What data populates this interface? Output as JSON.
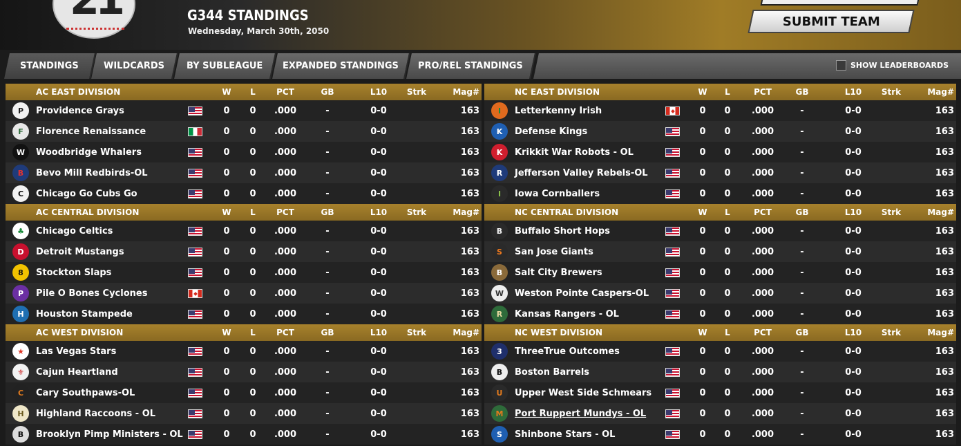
{
  "header": {
    "logo_text": "21",
    "title": "G344 STANDINGS",
    "date": "Wednesday, March 30th, 2050",
    "submit_label": "SUBMIT TEAM"
  },
  "tabs": [
    {
      "label": "STANDINGS",
      "active": true
    },
    {
      "label": "WILDCARDS",
      "active": false
    },
    {
      "label": "BY SUBLEAGUE",
      "active": false
    },
    {
      "label": "EXPANDED STANDINGS",
      "active": false
    },
    {
      "label": "PRO/REL STANDINGS",
      "active": false
    }
  ],
  "leaderboards_label": "SHOW LEADERBOARDS",
  "columns": {
    "w": "W",
    "l": "L",
    "pct": "PCT",
    "gb": "GB",
    "l10": "L10",
    "strk": "Strk",
    "mag": "Mag#"
  },
  "divisions": [
    {
      "name": "AC EAST DIVISION",
      "teams": [
        {
          "name": "Providence Grays",
          "logo": "P",
          "logo_bg": "#f2f2f2",
          "logo_fg": "#222",
          "flag": "us",
          "w": "0",
          "l": "0",
          "pct": ".000",
          "gb": "-",
          "l10": "0-0",
          "strk": "",
          "mag": "163"
        },
        {
          "name": "Florence Renaissance",
          "logo": "F",
          "logo_bg": "#e8e8e8",
          "logo_fg": "#2e6b3a",
          "flag": "it",
          "w": "0",
          "l": "0",
          "pct": ".000",
          "gb": "-",
          "l10": "0-0",
          "strk": "",
          "mag": "163"
        },
        {
          "name": "Woodbridge Whalers",
          "logo": "W",
          "logo_bg": "#111",
          "logo_fg": "#fff",
          "flag": "us",
          "w": "0",
          "l": "0",
          "pct": ".000",
          "gb": "-",
          "l10": "0-0",
          "strk": "",
          "mag": "163"
        },
        {
          "name": "Bevo Mill Redbirds-OL",
          "logo": "B",
          "logo_bg": "#1f3b7a",
          "logo_fg": "#d33",
          "flag": "us",
          "w": "0",
          "l": "0",
          "pct": ".000",
          "gb": "-",
          "l10": "0-0",
          "strk": "",
          "mag": "163"
        },
        {
          "name": "Chicago Go Cubs Go",
          "logo": "C",
          "logo_bg": "#f2f2f2",
          "logo_fg": "#111",
          "flag": "us",
          "w": "0",
          "l": "0",
          "pct": ".000",
          "gb": "-",
          "l10": "0-0",
          "strk": "",
          "mag": "163"
        }
      ]
    },
    {
      "name": "AC CENTRAL DIVISION",
      "teams": [
        {
          "name": "Chicago Celtics",
          "logo": "♣",
          "logo_bg": "#fff",
          "logo_fg": "#1a8a3a",
          "flag": "us",
          "w": "0",
          "l": "0",
          "pct": ".000",
          "gb": "-",
          "l10": "0-0",
          "strk": "",
          "mag": "163"
        },
        {
          "name": "Detroit Mustangs",
          "logo": "D",
          "logo_bg": "#c8102e",
          "logo_fg": "#fff",
          "flag": "us",
          "w": "0",
          "l": "0",
          "pct": ".000",
          "gb": "-",
          "l10": "0-0",
          "strk": "",
          "mag": "163"
        },
        {
          "name": "Stockton Slaps",
          "logo": "8",
          "logo_bg": "#f2c200",
          "logo_fg": "#111",
          "flag": "us",
          "w": "0",
          "l": "0",
          "pct": ".000",
          "gb": "-",
          "l10": "0-0",
          "strk": "",
          "mag": "163"
        },
        {
          "name": "Pile O Bones Cyclones",
          "logo": "P",
          "logo_bg": "#6b2fa3",
          "logo_fg": "#fff",
          "flag": "ca",
          "w": "0",
          "l": "0",
          "pct": ".000",
          "gb": "-",
          "l10": "0-0",
          "strk": "",
          "mag": "163"
        },
        {
          "name": "Houston Stampede",
          "logo": "H",
          "logo_bg": "#1f6fb2",
          "logo_fg": "#fff",
          "flag": "us",
          "w": "0",
          "l": "0",
          "pct": ".000",
          "gb": "-",
          "l10": "0-0",
          "strk": "",
          "mag": "163"
        }
      ]
    },
    {
      "name": "AC WEST DIVISION",
      "teams": [
        {
          "name": "Las Vegas Stars",
          "logo": "★",
          "logo_bg": "#fff",
          "logo_fg": "#d32",
          "flag": "us",
          "w": "0",
          "l": "0",
          "pct": ".000",
          "gb": "-",
          "l10": "0-0",
          "strk": "",
          "mag": "163"
        },
        {
          "name": "Cajun Heartland",
          "logo": "⚜",
          "logo_bg": "#f2f2f2",
          "logo_fg": "#c22",
          "flag": "us",
          "w": "0",
          "l": "0",
          "pct": ".000",
          "gb": "-",
          "l10": "0-0",
          "strk": "",
          "mag": "163"
        },
        {
          "name": "Cary Southpaws-OL",
          "logo": "C",
          "logo_bg": "#222",
          "logo_fg": "#e07a1e",
          "flag": "us",
          "w": "0",
          "l": "0",
          "pct": ".000",
          "gb": "-",
          "l10": "0-0",
          "strk": "",
          "mag": "163"
        },
        {
          "name": "Highland Raccoons - OL",
          "logo": "H",
          "logo_bg": "#efe7c8",
          "logo_fg": "#6b5a1e",
          "flag": "us",
          "w": "0",
          "l": "0",
          "pct": ".000",
          "gb": "-",
          "l10": "0-0",
          "strk": "",
          "mag": "163"
        },
        {
          "name": "Brooklyn Pimp Ministers - OL",
          "logo": "B",
          "logo_bg": "#ddd",
          "logo_fg": "#111",
          "flag": "us",
          "w": "0",
          "l": "0",
          "pct": ".000",
          "gb": "-",
          "l10": "0-0",
          "strk": "",
          "mag": "163"
        }
      ]
    },
    {
      "name": "NC EAST DIVISION",
      "teams": [
        {
          "name": "Letterkenny Irish",
          "logo": "I",
          "logo_bg": "#e06a1e",
          "logo_fg": "#1a8a3a",
          "flag": "ca",
          "w": "0",
          "l": "0",
          "pct": ".000",
          "gb": "-",
          "l10": "0-0",
          "strk": "",
          "mag": "163"
        },
        {
          "name": "Defense Kings",
          "logo": "K",
          "logo_bg": "#1f5fb2",
          "logo_fg": "#fff",
          "flag": "us",
          "w": "0",
          "l": "0",
          "pct": ".000",
          "gb": "-",
          "l10": "0-0",
          "strk": "",
          "mag": "163"
        },
        {
          "name": "Krikkit War Robots - OL",
          "logo": "K",
          "logo_bg": "#d01e2e",
          "logo_fg": "#fff",
          "flag": "us",
          "w": "0",
          "l": "0",
          "pct": ".000",
          "gb": "-",
          "l10": "0-0",
          "strk": "",
          "mag": "163"
        },
        {
          "name": "Jefferson Valley Rebels-OL",
          "logo": "R",
          "logo_bg": "#1f3b7a",
          "logo_fg": "#fff",
          "flag": "us",
          "w": "0",
          "l": "0",
          "pct": ".000",
          "gb": "-",
          "l10": "0-0",
          "strk": "",
          "mag": "163"
        },
        {
          "name": "Iowa Cornballers",
          "logo": "I",
          "logo_bg": "#2a2a2a",
          "logo_fg": "#8ac04a",
          "flag": "us",
          "w": "0",
          "l": "0",
          "pct": ".000",
          "gb": "-",
          "l10": "0-0",
          "strk": "",
          "mag": "163"
        }
      ]
    },
    {
      "name": "NC CENTRAL DIVISION",
      "teams": [
        {
          "name": "Buffalo Short Hops",
          "logo": "B",
          "logo_bg": "#2a2a2a",
          "logo_fg": "#eee",
          "flag": "us",
          "w": "0",
          "l": "0",
          "pct": ".000",
          "gb": "-",
          "l10": "0-0",
          "strk": "",
          "mag": "163"
        },
        {
          "name": "San Jose Giants",
          "logo": "S",
          "logo_bg": "#2a2a2a",
          "logo_fg": "#f07a1e",
          "flag": "us",
          "w": "0",
          "l": "0",
          "pct": ".000",
          "gb": "-",
          "l10": "0-0",
          "strk": "",
          "mag": "163"
        },
        {
          "name": "Salt City Brewers",
          "logo": "B",
          "logo_bg": "#8a6a3a",
          "logo_fg": "#fff",
          "flag": "us",
          "w": "0",
          "l": "0",
          "pct": ".000",
          "gb": "-",
          "l10": "0-0",
          "strk": "",
          "mag": "163"
        },
        {
          "name": "Weston Pointe Caspers-OL",
          "logo": "W",
          "logo_bg": "#eee",
          "logo_fg": "#333",
          "flag": "us",
          "w": "0",
          "l": "0",
          "pct": ".000",
          "gb": "-",
          "l10": "0-0",
          "strk": "",
          "mag": "163"
        },
        {
          "name": "Kansas Rangers - OL",
          "logo": "R",
          "logo_bg": "#2e6b3a",
          "logo_fg": "#e8d9a0",
          "flag": "us",
          "w": "0",
          "l": "0",
          "pct": ".000",
          "gb": "-",
          "l10": "0-0",
          "strk": "",
          "mag": "163"
        }
      ]
    },
    {
      "name": "NC WEST DIVISION",
      "teams": [
        {
          "name": "ThreeTrue Outcomes",
          "logo": "3",
          "logo_bg": "#1f2f6b",
          "logo_fg": "#fff",
          "flag": "us",
          "w": "0",
          "l": "0",
          "pct": ".000",
          "gb": "-",
          "l10": "0-0",
          "strk": "",
          "mag": "163"
        },
        {
          "name": "Boston Barrels",
          "logo": "B",
          "logo_bg": "#eee",
          "logo_fg": "#111",
          "flag": "us",
          "w": "0",
          "l": "0",
          "pct": ".000",
          "gb": "-",
          "l10": "0-0",
          "strk": "",
          "mag": "163"
        },
        {
          "name": "Upper West Side Schmears",
          "logo": "U",
          "logo_bg": "#2a2a2a",
          "logo_fg": "#e07a1e",
          "flag": "us",
          "w": "0",
          "l": "0",
          "pct": ".000",
          "gb": "-",
          "l10": "0-0",
          "strk": "",
          "mag": "163"
        },
        {
          "name": "Port Ruppert Mundys - OL",
          "logo": "M",
          "logo_bg": "#2e6b3a",
          "logo_fg": "#e07a1e",
          "flag": "us",
          "w": "0",
          "l": "0",
          "pct": ".000",
          "gb": "-",
          "l10": "0-0",
          "strk": "",
          "mag": "163",
          "underlined": true
        },
        {
          "name": "Shinbone Stars - OL",
          "logo": "S",
          "logo_bg": "#1f5fb2",
          "logo_fg": "#fff",
          "flag": "us",
          "w": "0",
          "l": "0",
          "pct": ".000",
          "gb": "-",
          "l10": "0-0",
          "strk": "",
          "mag": "163"
        }
      ]
    }
  ]
}
